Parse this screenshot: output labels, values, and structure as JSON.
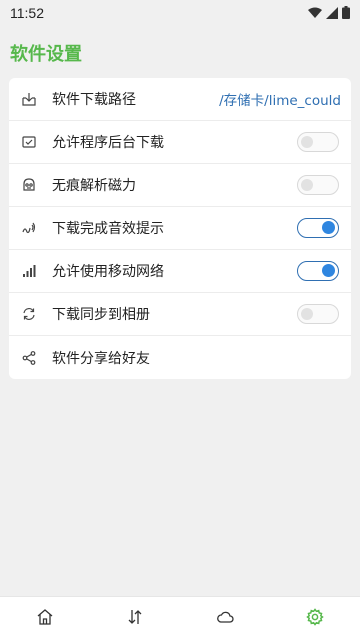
{
  "status_bar": {
    "time": "11:52",
    "icons": [
      "wifi-icon",
      "signal-icon",
      "battery-icon"
    ]
  },
  "page": {
    "title": "软件设置",
    "title_color": "#57b84c"
  },
  "settings": [
    {
      "icon": "download-box-icon",
      "label": "软件下载路径",
      "type": "value",
      "value": "/存储卡/lime_could"
    },
    {
      "icon": "background-download-icon",
      "label": "允许程序后台下载",
      "type": "toggle",
      "on": false
    },
    {
      "icon": "incognito-icon",
      "label": "无痕解析磁力",
      "type": "toggle",
      "on": false
    },
    {
      "icon": "sound-icon",
      "label": "下载完成音效提示",
      "type": "toggle",
      "on": true
    },
    {
      "icon": "signal-bars-icon",
      "label": "允许使用移动网络",
      "type": "toggle",
      "on": true
    },
    {
      "icon": "sync-icon",
      "label": "下载同步到相册",
      "type": "toggle",
      "on": false
    },
    {
      "icon": "share-icon",
      "label": "软件分享给好友",
      "type": "none"
    }
  ],
  "bottom_nav": [
    {
      "icon": "home-icon",
      "active": false
    },
    {
      "icon": "transfer-icon",
      "active": false
    },
    {
      "icon": "cloud-icon",
      "active": false
    },
    {
      "icon": "settings-gear-icon",
      "active": true
    }
  ],
  "colors": {
    "accent": "#57b84c",
    "toggle_on": "#2f86e0",
    "link": "#2f6fb2",
    "background": "#f0f0f0"
  }
}
